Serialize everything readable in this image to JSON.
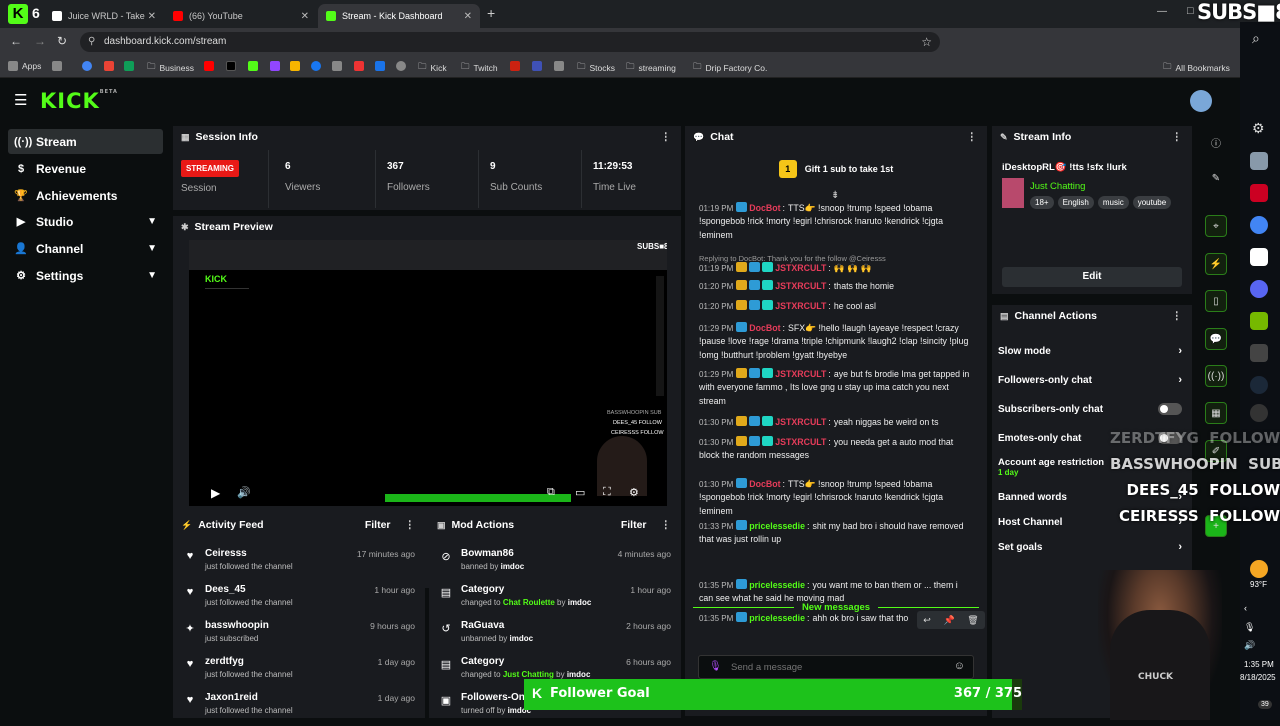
{
  "browser": {
    "tabs": [
      {
        "title": "Juice WRLD - Take My Soul",
        "close": "✕"
      },
      {
        "title": "(66) YouTube",
        "close": "✕"
      },
      {
        "title": "Stream - Kick Dashboard",
        "close": "✕"
      }
    ],
    "tab_count": "6",
    "new_tab": "+",
    "url": "dashboard.kick.com/stream",
    "bookmarks": [
      "Apps",
      "Business",
      "Kick",
      "Twitch",
      "Stocks",
      "streaming",
      "Drip Factory Co."
    ],
    "all_bookmarks": "All Bookmarks",
    "window_controls": [
      "—",
      "□",
      "✕"
    ]
  },
  "brand": {
    "logo": "KICK",
    "beta": "BETA"
  },
  "sidebar": {
    "items": [
      {
        "label": "Stream",
        "icon": "stream-icon"
      },
      {
        "label": "Revenue",
        "icon": "dollar-icon"
      },
      {
        "label": "Achievements",
        "icon": "trophy-icon"
      },
      {
        "label": "Studio",
        "icon": "video-icon"
      },
      {
        "label": "Channel",
        "icon": "user-icon"
      },
      {
        "label": "Settings",
        "icon": "gear-icon"
      }
    ]
  },
  "session": {
    "title": "Session Info",
    "status": "STREAMING",
    "status_label": "Session",
    "stats": [
      {
        "value": "6",
        "label": "Viewers"
      },
      {
        "value": "367",
        "label": "Followers"
      },
      {
        "value": "9",
        "label": "Sub Counts"
      },
      {
        "value": "11:29:53",
        "label": "Time Live"
      }
    ]
  },
  "preview": {
    "title": "Stream Preview",
    "inner_logo": "KICK",
    "inner_subs": "SUBS■8",
    "inner_alerts": [
      "BASSWHOOPIN SUB",
      "DEES_45 FOLLOW",
      "CEIRESSS FOLLOW"
    ]
  },
  "activity": {
    "title": "Activity Feed",
    "filter": "Filter",
    "items": [
      {
        "name": "Ceiresss",
        "sub": "just followed the channel",
        "time": "17 minutes ago",
        "icon": "heart-icon"
      },
      {
        "name": "Dees_45",
        "sub": "just followed the channel",
        "time": "1 hour ago",
        "icon": "heart-icon"
      },
      {
        "name": "basswhoopin",
        "sub": "just subscribed",
        "time": "9 hours ago",
        "icon": "star-icon"
      },
      {
        "name": "zerdtfyg",
        "sub": "just followed the channel",
        "time": "1 day ago",
        "icon": "heart-icon"
      },
      {
        "name": "Jaxon1reid",
        "sub": "just followed the channel",
        "time": "1 day ago",
        "icon": "heart-icon"
      }
    ]
  },
  "mod": {
    "title": "Mod Actions",
    "filter": "Filter",
    "items": [
      {
        "name": "Bowman86",
        "pre": "banned by ",
        "hl": "",
        "mid": "",
        "by": "imdoc",
        "time": "4 minutes ago",
        "icon": "ban-icon"
      },
      {
        "name": "Category",
        "pre": "changed to ",
        "hl": "Chat Roulette",
        "mid": " by ",
        "by": "imdoc",
        "time": "1 hour ago",
        "icon": "category-icon"
      },
      {
        "name": "RaGuava",
        "pre": "unbanned by ",
        "hl": "",
        "mid": "",
        "by": "imdoc",
        "time": "2 hours ago",
        "icon": "undo-icon"
      },
      {
        "name": "Category",
        "pre": "changed to ",
        "hl": "Just Chatting",
        "mid": " by ",
        "by": "imdoc",
        "time": "6 hours ago",
        "icon": "category-icon"
      },
      {
        "name": "Followers-Only",
        "pre": "turned off by ",
        "hl": "",
        "mid": "",
        "by": "imdoc",
        "time": "",
        "icon": "chat-icon"
      }
    ]
  },
  "chat": {
    "title": "Chat",
    "gift": "Gift 1 sub to take 1st",
    "gift_num": "1",
    "reply_note": "Replying to DocBot: Thank you for the follow @Ceiresss",
    "new_messages": "New messages",
    "input_placeholder": "Send a message",
    "messages": [
      {
        "t": "01:19 PM",
        "u": "DocBot",
        "c": "#e63c5a",
        "text": "TTS👉 !snoop !trump !speed !obama !spongebob !rick !morty !egirl !chrisrock !naruto !kendrick !cjgta !eminem"
      },
      {
        "t": "01:19 PM",
        "u": "JSTXRCULT",
        "c": "#e63c5a",
        "text": "🙌 🙌 🙌"
      },
      {
        "t": "01:20 PM",
        "u": "JSTXRCULT",
        "c": "#e63c5a",
        "text": "thats the homie"
      },
      {
        "t": "01:20 PM",
        "u": "JSTXRCULT",
        "c": "#e63c5a",
        "text": "he cool asl"
      },
      {
        "t": "01:29 PM",
        "u": "DocBot",
        "c": "#e63c5a",
        "text": "SFX👉 !hello !laugh !ayeaye !respect !crazy !pause !love !rage !drama !triple !chipmunk !laugh2 !clap !sincity !plug !omg !butthurt !problem !gyatt !byebye"
      },
      {
        "t": "01:29 PM",
        "u": "JSTXRCULT",
        "c": "#e63c5a",
        "text": "aye but fs brodie Ima get tapped in with everyone fammo , Its love gng u stay up ima catch you next stream"
      },
      {
        "t": "01:30 PM",
        "u": "JSTXRCULT",
        "c": "#e63c5a",
        "text": "yeah niggas be weird on ts"
      },
      {
        "t": "01:30 PM",
        "u": "JSTXRCULT",
        "c": "#e63c5a",
        "text": "you needa get a auto mod that block the random messages"
      },
      {
        "t": "01:30 PM",
        "u": "DocBot",
        "c": "#e63c5a",
        "text": "TTS👉 !snoop !trump !speed !obama !spongebob !rick !morty !egirl !chrisrock !naruto !kendrick !cjgta !eminem"
      },
      {
        "t": "01:33 PM",
        "u": "pricelessedie",
        "c": "#53fc18",
        "text": "shit my bad bro i should have removed that was just rollin up"
      },
      {
        "t": "01:35 PM",
        "u": "pricelessedie",
        "c": "#53fc18",
        "text": "you want me to ban them or ... them i can see what he said he moving mad"
      },
      {
        "t": "01:35 PM",
        "u": "pricelessedie",
        "c": "#53fc18",
        "text": "ahh ok bro i saw that tho"
      }
    ]
  },
  "stream_info": {
    "title": "Stream Info",
    "stream_title": "iDesktopRL🎯 !tts !sfx !lurk",
    "category": "Just Chatting",
    "tags": [
      "18+",
      "English",
      "music",
      "youtube"
    ],
    "edit": "Edit"
  },
  "channel_actions": {
    "title": "Channel Actions",
    "items": [
      {
        "label": "Slow mode",
        "type": "arrow"
      },
      {
        "label": "Followers-only chat",
        "type": "arrow"
      },
      {
        "label": "Subscribers-only chat",
        "type": "toggle"
      },
      {
        "label": "Emotes-only chat",
        "type": "toggle"
      },
      {
        "label": "Account age restriction",
        "type": "arrow",
        "sub": "1 day"
      },
      {
        "label": "Banned words",
        "type": "arrow"
      },
      {
        "label": "Host Channel",
        "type": "arrow"
      },
      {
        "label": "Set goals",
        "type": "arrow"
      }
    ]
  },
  "overlay": {
    "subs": "SUBS■8",
    "alerts": [
      {
        "name": "ZERDTFYG",
        "type": "FOLLOW"
      },
      {
        "name": "BASSWHOOPIN",
        "type": "SUB"
      },
      {
        "name": "DEES_45",
        "type": "FOLLOW"
      },
      {
        "name": "CEIRESSS",
        "type": "FOLLOW"
      }
    ],
    "goal_label": "Follower Goal",
    "goal_value": "367 / 375",
    "goal_progress": 0.979,
    "cam_text": "CHUCK"
  },
  "system": {
    "weather": "93°F",
    "time": "1:35 PM",
    "date": "8/18/2025",
    "notif": "39"
  },
  "colors": {
    "accent": "#53fc18",
    "live": "#e91916",
    "panel": "#191b1f",
    "bg": "#0b0e0f"
  }
}
